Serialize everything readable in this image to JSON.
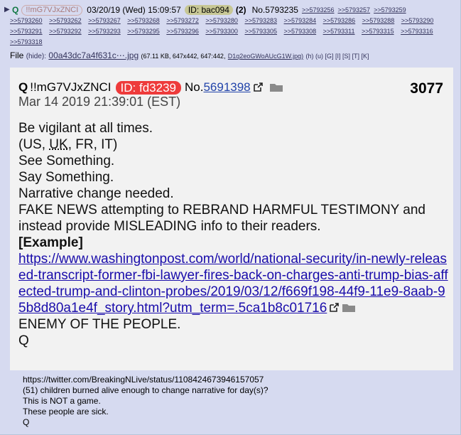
{
  "header": {
    "arrow": "▶",
    "name": "Q",
    "trip": "!!mG7VJxZNCI",
    "datetime": "03/20/19 (Wed) 15:09:57",
    "id_label": "ID: bac094",
    "reply_count": "(2)",
    "post_number": "No.5793235",
    "backlinks": [
      ">>5793256",
      ">>5793257",
      ">>5793259",
      ">>5793260",
      ">>5793262",
      ">>5793267",
      ">>5793268",
      ">>5793272",
      ">>5793280",
      ">>5793283",
      ">>5793284",
      ">>5793286",
      ">>5793288",
      ">>5793290",
      ">>5793291",
      ">>5793292",
      ">>5793293",
      ">>5793295",
      ">>5793296",
      ">>5793300",
      ">>5793305",
      ">>5793308",
      ">>5793311",
      ">>5793315",
      ">>5793316",
      ">>5793318"
    ]
  },
  "file": {
    "label": "File",
    "hide": "(hide):",
    "name": "00a43dc7a4f631c⋯.jpg",
    "meta": "(67.11 KB, 647x442, 647:442,",
    "orig": "D1q2eoGWoAUcG1W.jpg)",
    "links": "(h) (u) [G] [I] [S] [T] [K]"
  },
  "screenshot": {
    "name": "Q",
    "trip": "!!mG7VJxZNCI",
    "id_label": "ID: fd3239",
    "no_prefix": "No.",
    "no_link": "5691398",
    "post_index": "3077",
    "date": "Mar 14 2019 21:39:01 (EST)",
    "lines": [
      "Be vigilant at all times.",
      "(US, UK, FR, IT)",
      "See Something.",
      "Say Something.",
      "Narrative change needed.",
      "FAKE NEWS attempting to REBRAND HARMFUL TESTIMONY and instead provide MISLEADING info to their readers."
    ],
    "example_label": "[Example]",
    "url": "https://www.washingtonpost.com/world/national-security/in-newly-released-transcript-former-fbi-lawyer-fires-back-on-charges-anti-trump-bias-affected-trump-and-clinton-probes/2019/03/12/f669f198-44f9-11e9-8aab-95b8d80a1e4f_story.html?utm_term=.5ca1b8c01716",
    "enemy": "ENEMY OF THE PEOPLE.",
    "sign": "Q"
  },
  "comment": {
    "lines": [
      "https://twitter.com/BreakingNLive/status/1108424673946157057",
      "(51) children burned alive enough to change narrative for day(s)?",
      "This is NOT a game.",
      "These people are sick.",
      "Q"
    ]
  },
  "colors": {
    "post_bg": "#d6daf0",
    "name": "#117743",
    "id_badge": "#c7c795",
    "q_id_badge": "#ee3b3b",
    "link": "#34345c"
  }
}
